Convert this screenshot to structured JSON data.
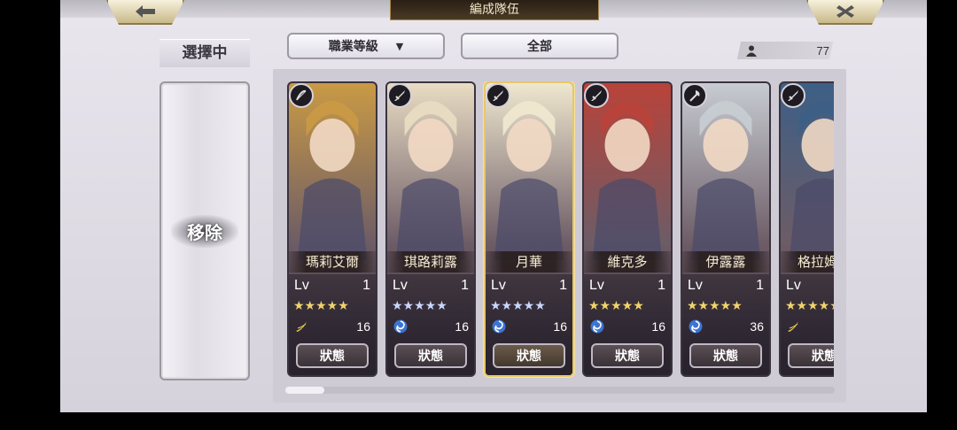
{
  "header": {
    "title": "編成隊伍",
    "back_icon": "arrow-left-icon",
    "close_icon": "close-x-icon"
  },
  "left_panel": {
    "selecting_label": "選擇中",
    "remove_label": "移除"
  },
  "filters": {
    "job_filter_label": "職業等級",
    "job_filter_icon": "caret-down-icon",
    "all_filter_label": "全部"
  },
  "owned_count": {
    "icon": "person-icon",
    "value": "77"
  },
  "colors": {
    "accent_gold": "#e8c768",
    "dark_panel": "#2d2630"
  },
  "units": [
    {
      "name": "瑪莉艾爾",
      "lv_label": "Lv",
      "level": "1",
      "stars": "★★★★★",
      "star_color": "gold",
      "element_icon": "wind-icon",
      "cost": "16",
      "status_label": "狀態",
      "class_icon": "bow-icon",
      "selected": false,
      "portrait_color": "#c99a45"
    },
    {
      "name": "琪路莉露",
      "lv_label": "Lv",
      "level": "1",
      "stars": "★★★★★",
      "star_color": "silver",
      "element_icon": "water-swirl-icon",
      "cost": "16",
      "status_label": "狀態",
      "class_icon": "sword-icon",
      "selected": false,
      "portrait_color": "#e8dcc3"
    },
    {
      "name": "月華",
      "lv_label": "Lv",
      "level": "1",
      "stars": "★★★★★",
      "star_color": "silver",
      "element_icon": "water-swirl-icon",
      "cost": "16",
      "status_label": "狀態",
      "class_icon": "sword-icon",
      "selected": true,
      "portrait_color": "#efe7cf"
    },
    {
      "name": "維克多",
      "lv_label": "Lv",
      "level": "1",
      "stars": "★★★★★",
      "star_color": "gold",
      "element_icon": "water-swirl-icon",
      "cost": "16",
      "status_label": "狀態",
      "class_icon": "sword-icon",
      "selected": false,
      "portrait_color": "#b8433a"
    },
    {
      "name": "伊露露",
      "lv_label": "Lv",
      "level": "1",
      "stars": "★★★★★",
      "star_color": "gold",
      "element_icon": "water-swirl-icon",
      "cost": "36",
      "status_label": "狀態",
      "class_icon": "axe-icon",
      "selected": false,
      "portrait_color": "#c7ccd2"
    },
    {
      "name": "格拉姆巴",
      "lv_label": "Lv",
      "level": "",
      "stars": "★★★★★",
      "star_color": "gold",
      "element_icon": "wind-icon",
      "cost": "",
      "status_label": "狀態",
      "class_icon": "sword-icon",
      "selected": false,
      "portrait_color": "#3d5f86"
    }
  ]
}
